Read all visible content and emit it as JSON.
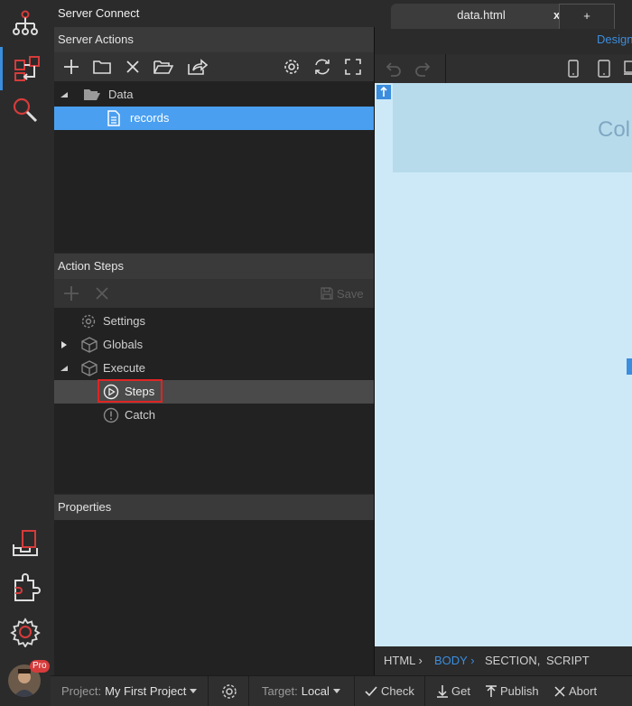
{
  "panel": {
    "title": "Server Connect",
    "server_actions_header": "Server Actions",
    "tree": [
      {
        "label": "Data"
      },
      {
        "label": "records"
      }
    ],
    "action_steps_header": "Action Steps",
    "save_label": "Save",
    "steps": [
      {
        "label": "Settings"
      },
      {
        "label": "Globals"
      },
      {
        "label": "Execute"
      },
      {
        "label": "Steps"
      },
      {
        "label": "Catch"
      }
    ],
    "properties_header": "Properties"
  },
  "tabs": {
    "active": "data.html",
    "close": "x",
    "add": "+"
  },
  "view_mode": "Design",
  "canvas": {
    "heading_fragment": "Col"
  },
  "breadcrumb": [
    "HTML",
    "BODY",
    "SECTION,",
    "SCRIPT"
  ],
  "bottombar": {
    "project_label": "Project:",
    "project_value": "My First Project",
    "target_label": "Target:",
    "target_value": "Local",
    "check": "Check",
    "get": "Get",
    "publish": "Publish",
    "abort": "Abort"
  },
  "user": {
    "badge": "Pro"
  },
  "colors": {
    "accent": "#3b8dde",
    "selected_row": "#4a9ff0",
    "highlight_box": "#e02424",
    "icon_red": "#d63b3b",
    "canvas_bg": "#cde9f8"
  }
}
